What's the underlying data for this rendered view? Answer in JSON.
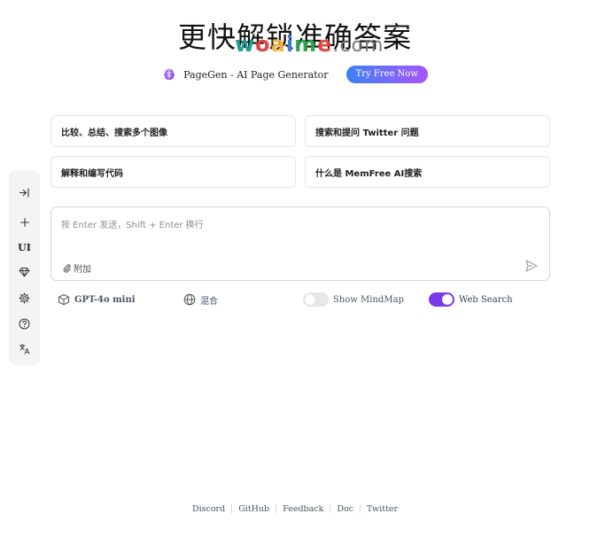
{
  "header": {
    "headline": "更快解锁准确答案",
    "watermark_letters": [
      "w",
      "o",
      "a",
      "i",
      "m",
      "e"
    ],
    "watermark_tld": ".com"
  },
  "promo": {
    "icon": "pagegen-brain-icon",
    "text": "PageGen - AI Page Generator",
    "cta": "Try Free Now"
  },
  "suggestions": [
    "比较、总结、搜索多个图像",
    "搜索和提问 Twitter 问题",
    "解释和编写代码",
    "什么是 MemFree AI搜索"
  ],
  "input": {
    "placeholder": "按 Enter 发送，Shift + Enter 换行",
    "attach_label": "附加"
  },
  "options": {
    "model": "GPT-4o mini",
    "source": "混合",
    "mindmap": {
      "label": "Show MindMap",
      "enabled": false
    },
    "websearch": {
      "label": "Web Search",
      "enabled": true
    }
  },
  "sidebar": {
    "items": [
      "expand-icon",
      "plus-icon",
      "UI",
      "diamond-icon",
      "gear-icon",
      "help-icon",
      "translate-icon"
    ]
  },
  "footer": {
    "links": [
      "Discord",
      "GitHub",
      "Feedback",
      "Doc",
      "Twitter"
    ]
  },
  "colors": {
    "accent": "#7c3aed",
    "cta_start": "#3b82f6",
    "cta_end": "#a855f7",
    "border": "#e5e7eb"
  }
}
